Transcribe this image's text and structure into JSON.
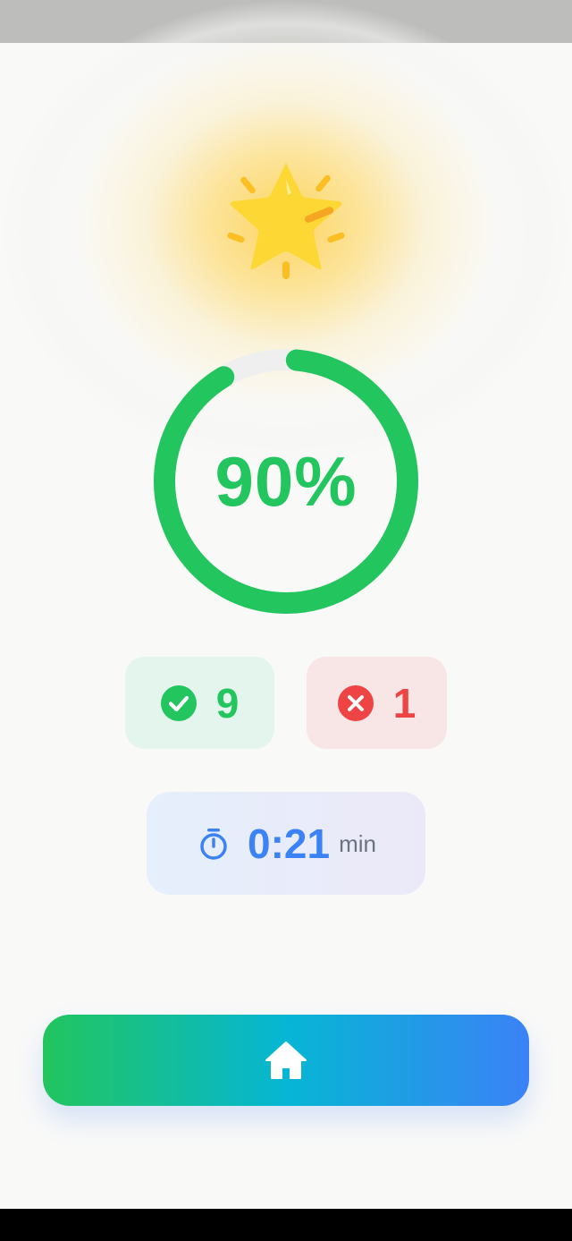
{
  "result": {
    "score": 0.9,
    "score_label": "90%",
    "correct_count": "9",
    "wrong_count": "1",
    "time_value": "0:21",
    "time_unit": "min"
  },
  "icons": {
    "badge": "star-icon",
    "correct": "check-circle-icon",
    "wrong": "x-circle-icon",
    "timer": "stopwatch-icon",
    "home": "home-icon"
  },
  "colors": {
    "accent_green": "#22c55e",
    "accent_red": "#ef4444",
    "accent_blue": "#3b82f6",
    "star_yellow": "#fdd835"
  }
}
